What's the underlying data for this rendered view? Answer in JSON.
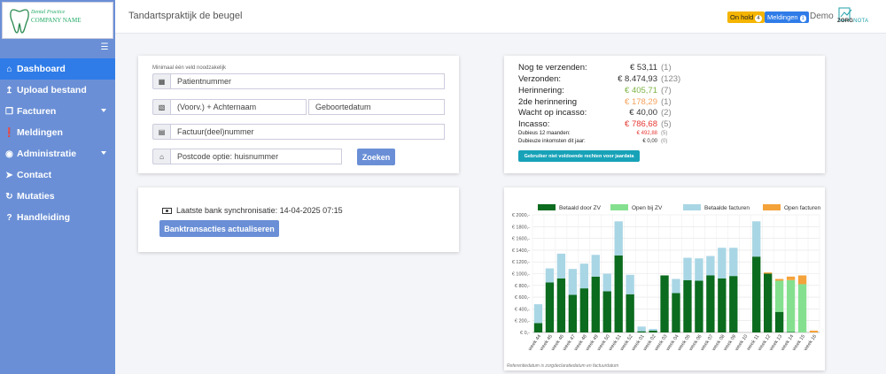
{
  "app": {
    "title": "Tandartspraktijk de beugel",
    "logo_line1": "Dental Practice",
    "logo_line2": "COMPANY NAME"
  },
  "header": {
    "onhold_label": "On hold",
    "onhold_count": "4",
    "meldingen_label": "Meldingen",
    "meldingen_count": "1",
    "demo_label": "Demo",
    "brand_zorg": "ZORG",
    "brand_nota": "NOTA"
  },
  "sidebar": {
    "items": [
      {
        "label": "Dashboard",
        "icon": "home-icon",
        "active": true
      },
      {
        "label": "Upload bestand",
        "icon": "upload-icon"
      },
      {
        "label": "Facturen",
        "icon": "copy-icon",
        "dropdown": true
      },
      {
        "label": "Meldingen",
        "icon": "exclamation-icon"
      },
      {
        "label": "Administratie",
        "icon": "euro-icon",
        "dropdown": true
      },
      {
        "label": "Contact",
        "icon": "paper-plane-icon"
      },
      {
        "label": "Mutaties",
        "icon": "sync-icon"
      },
      {
        "label": "Handleiding",
        "icon": "question-icon"
      }
    ]
  },
  "search": {
    "hint": "Minimaal één veld noodzakelijk",
    "patient_placeholder": "Patientnummer",
    "name_placeholder": "(Voorv.) + Achternaam",
    "birth_placeholder": "Geboortedatum",
    "invoice_placeholder": "Factuur(deel)nummer",
    "postcode_placeholder": "Postcode optie: huisnummer",
    "button": "Zoeken"
  },
  "bank": {
    "sync_text": "Laatste bank synchronisatie: 14-04-2025 07:15",
    "button": "Banktransacties actualiseren"
  },
  "stats": {
    "rows": [
      {
        "label": "Nog te verzenden:",
        "value": "€ 53,11",
        "count": "(1)",
        "color": "#333333",
        "size": "big"
      },
      {
        "label": "Verzonden:",
        "value": "€ 8.474,93",
        "count": "(123)",
        "color": "#333333",
        "size": "big"
      },
      {
        "label": "Herinnering:",
        "value": "€ 405,71",
        "count": "(7)",
        "color": "#7cb342",
        "size": "big"
      },
      {
        "label": "2de herinnering",
        "value": "€ 178,29",
        "count": "(1)",
        "color": "#f5a05a",
        "size": "big"
      },
      {
        "label": "Wacht op incasso:",
        "value": "€ 40,00",
        "count": "(2)",
        "color": "#333333",
        "size": "big"
      },
      {
        "label": "Incasso:",
        "value": "€ 786,68",
        "count": "(5)",
        "color": "#e53935",
        "size": "big"
      },
      {
        "label": "Dubieus 12 maanden:",
        "value": "€ 492,88",
        "count": "(5)",
        "color": "#e53935",
        "size": "small"
      },
      {
        "label": "Dubieuze inkomsten dit jaar:",
        "value": "€ 0,00",
        "count": "(0)",
        "color": "#333333",
        "size": "small"
      }
    ],
    "rights_button": "Gebruiker niet voldoende rechten voor jaardata"
  },
  "chart_data": {
    "type": "bar",
    "stacked": true,
    "categories": [
      "week 44",
      "week 45",
      "week 46",
      "week 47",
      "week 48",
      "week 49",
      "week 50",
      "week 51",
      "week 52",
      "week 01",
      "week 02",
      "week 03",
      "week 04",
      "week 05",
      "week 06",
      "week 07",
      "week 08",
      "week 09",
      "week 10",
      "week 11",
      "week 12",
      "week 13",
      "week 14",
      "week 15",
      "week 16"
    ],
    "series": [
      {
        "name": "Betaald door ZV",
        "color": "#0b6b1e",
        "values": [
          160,
          850,
          920,
          640,
          750,
          950,
          700,
          1310,
          650,
          20,
          30,
          970,
          670,
          890,
          880,
          970,
          920,
          960,
          0,
          1290,
          1000,
          350,
          10,
          0,
          0
        ]
      },
      {
        "name": "Open bij ZV",
        "color": "#84e08f",
        "values": [
          0,
          0,
          0,
          0,
          0,
          0,
          0,
          0,
          0,
          0,
          0,
          0,
          0,
          0,
          0,
          0,
          0,
          0,
          0,
          0,
          0,
          530,
          880,
          820,
          0
        ]
      },
      {
        "name": "Betaalde facturen",
        "color": "#a9d6e5",
        "values": [
          320,
          240,
          420,
          440,
          420,
          370,
          300,
          580,
          330,
          80,
          30,
          0,
          240,
          380,
          380,
          330,
          520,
          480,
          0,
          600,
          0,
          0,
          0,
          0,
          0
        ]
      },
      {
        "name": "Open facturen",
        "color": "#f4a23a",
        "values": [
          0,
          0,
          0,
          0,
          0,
          0,
          0,
          0,
          0,
          0,
          0,
          0,
          0,
          0,
          0,
          0,
          0,
          0,
          0,
          0,
          20,
          30,
          60,
          150,
          30
        ]
      }
    ],
    "ylim": [
      0,
      2000
    ],
    "yticks": [
      "€ 0,-",
      "€ 200,-",
      "€ 400,-",
      "€ 600,-",
      "€ 800,-",
      "€ 1000,-",
      "€ 1200,-",
      "€ 1400,-",
      "€ 1600,-",
      "€ 1800,-",
      "€ 2000,-"
    ],
    "legend": "top",
    "grid": true,
    "note": "Referentiedatum is zorgdeclaratiedatum en factuurdatum"
  }
}
